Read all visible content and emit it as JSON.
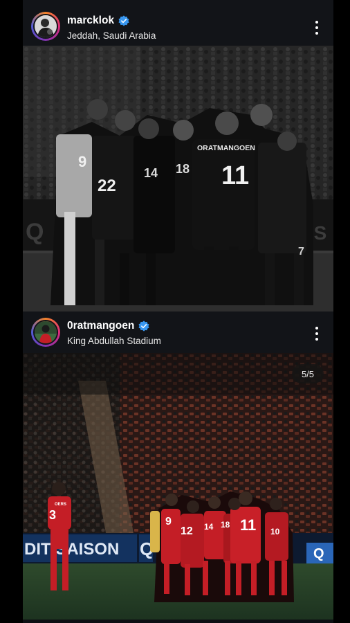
{
  "posts": [
    {
      "username": "marcklok",
      "location": "Jeddah, Saudi Arabia",
      "verified": true,
      "photo": {
        "style": "black-and-white",
        "jersey_numbers": [
          "9",
          "22",
          "14",
          "18",
          "11",
          "7"
        ],
        "jersey_name": "ORATMANGOEN",
        "board_text_left": "Q",
        "board_text_right": "YS"
      }
    },
    {
      "username": "0ratmangoen",
      "location": "King Abdullah Stadium",
      "verified": true,
      "photo": {
        "style": "color",
        "carousel_counter": "5/5",
        "jersey_numbers": [
          "3",
          "9",
          "12",
          "14",
          "18",
          "11",
          "10"
        ],
        "jersey_name": "OERS",
        "board_text_left": "DIT SAISON",
        "board_text_mid": "Q",
        "board_text_right": "Q"
      }
    }
  ],
  "colors": {
    "verified_badge": "#3897f0",
    "background": "#121418",
    "team_red": "#c41e26"
  },
  "icons": [
    "verified-badge-icon",
    "more-options-icon"
  ]
}
